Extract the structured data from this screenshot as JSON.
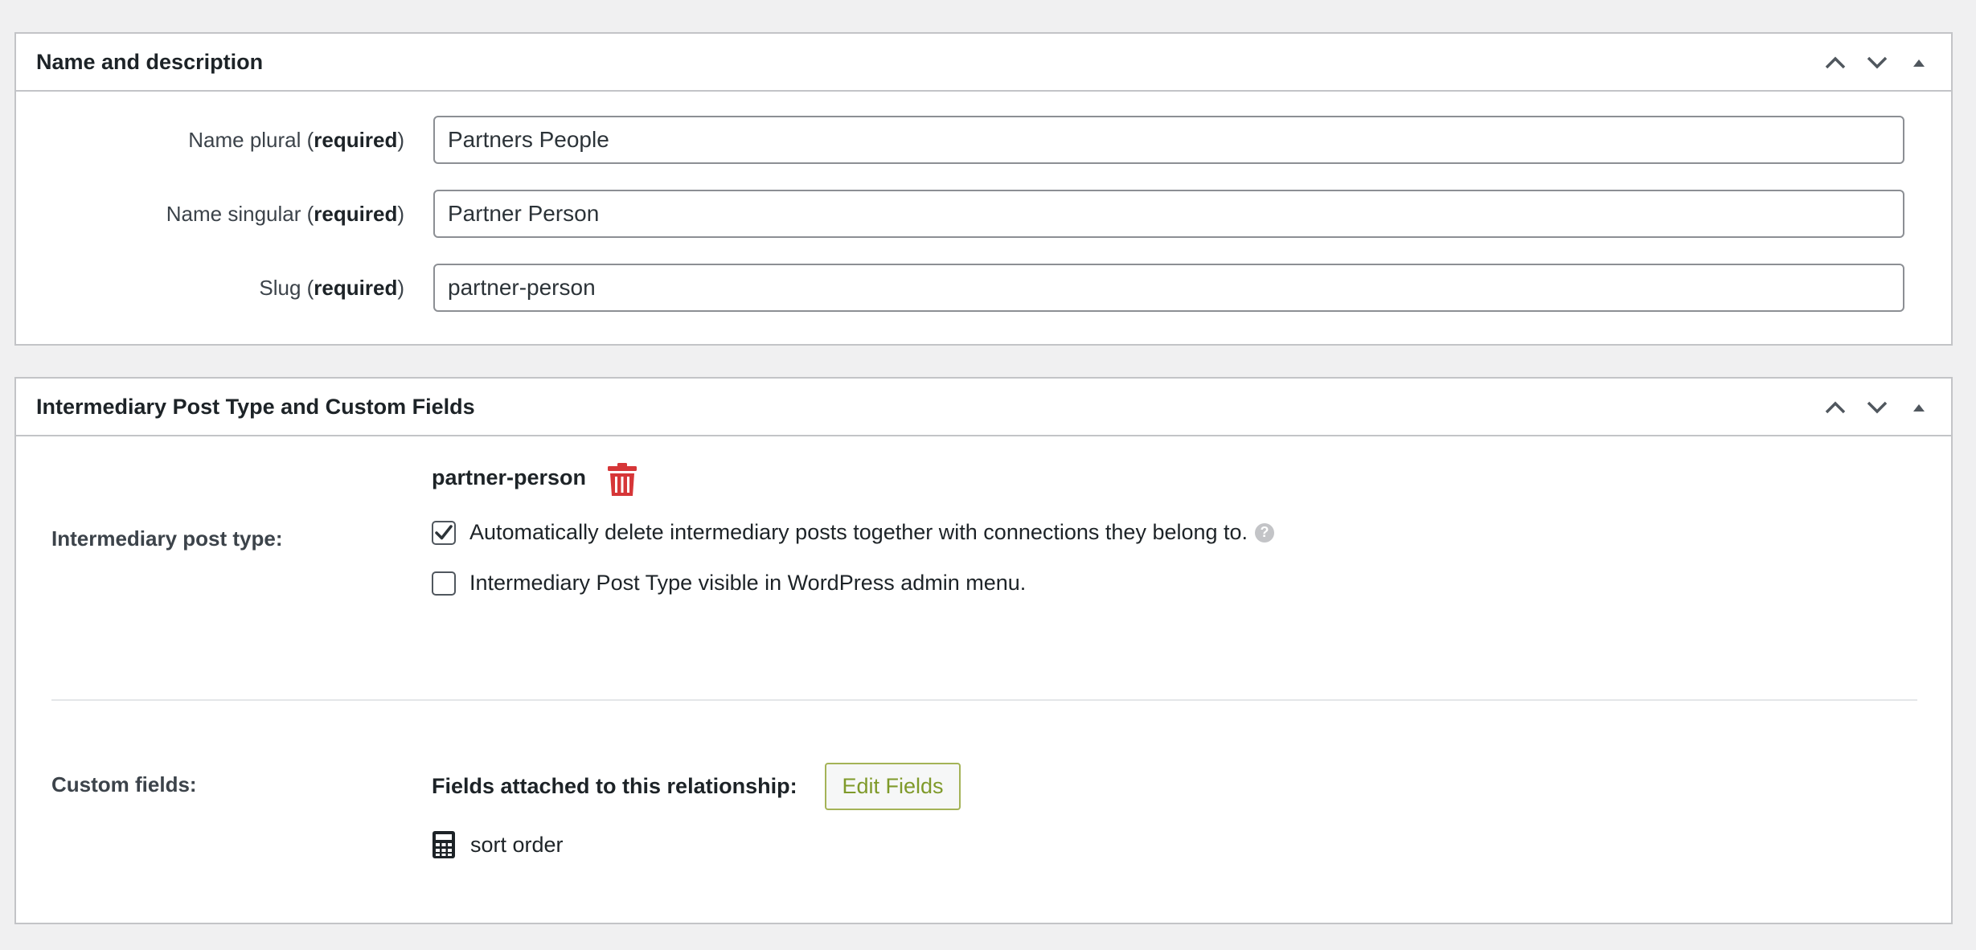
{
  "name_description": {
    "title": "Name and description",
    "fields": [
      {
        "label": "Name plural (",
        "required": "required",
        "close": ")",
        "value": "Partners People"
      },
      {
        "label": "Name singular (",
        "required": "required",
        "close": ")",
        "value": "Partner Person"
      },
      {
        "label": "Slug (",
        "required": "required",
        "close": ")",
        "value": "partner-person"
      }
    ]
  },
  "intermediary": {
    "title": "Intermediary Post Type and Custom Fields",
    "post_type_label": "Intermediary post type:",
    "post_type_name": "partner-person",
    "auto_delete": {
      "label": "Automatically delete intermediary posts together with connections they belong to.",
      "checked": true
    },
    "admin_menu": {
      "label": "Intermediary Post Type visible in WordPress admin menu.",
      "checked": false
    },
    "help_glyph": "?",
    "custom_fields_label": "Custom fields:",
    "fields_attached_label": "Fields attached to this relationship:",
    "edit_fields_label": "Edit Fields",
    "field_items": [
      {
        "name": "sort order",
        "icon": "calculator-icon"
      }
    ]
  },
  "colors": {
    "trash": "#d63638",
    "edit_button": "#7f9a2a",
    "border": "#c3c4c7"
  }
}
